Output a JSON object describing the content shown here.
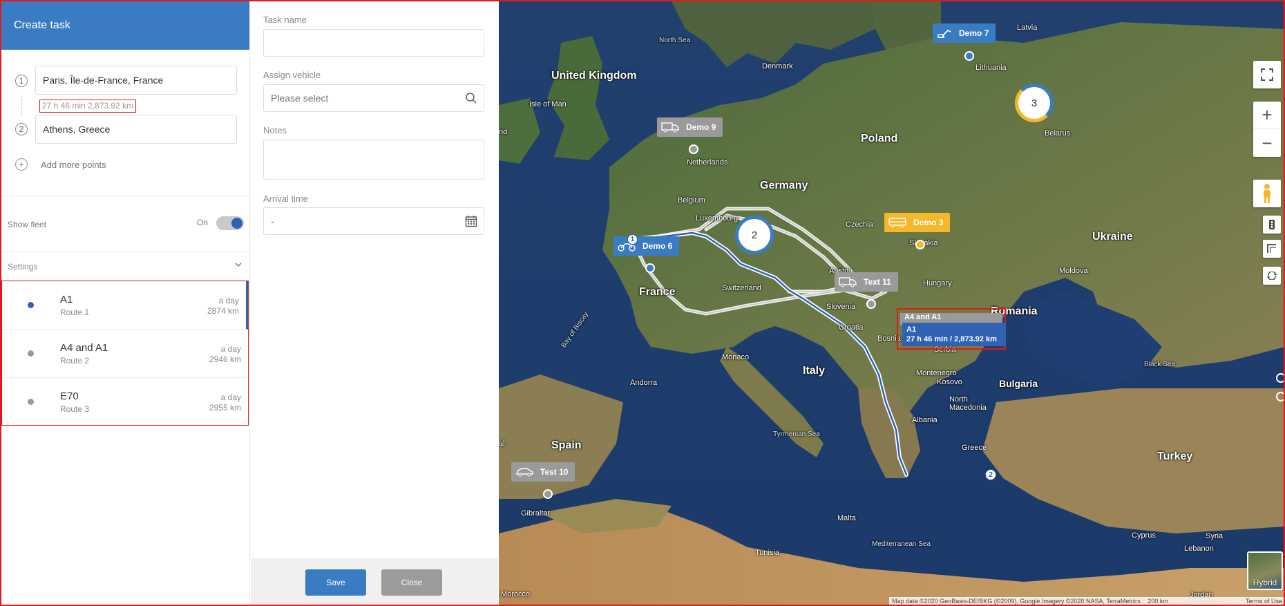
{
  "panel": {
    "title": "Create task",
    "points": [
      {
        "index": "1",
        "value": "Paris, Île-de-France, France"
      },
      {
        "index": "2",
        "value": "Athens, Greece"
      }
    ],
    "route_summary": "27 h 46 min 2,873.92 km",
    "add_more_label": "Add more points",
    "show_fleet_label": "Show fleet",
    "show_fleet_state": "On",
    "settings_label": "Settings",
    "routes": [
      {
        "name": "A1",
        "sub": "Route 1",
        "time": "a day",
        "distance": "2874 km",
        "active": true
      },
      {
        "name": "A4 and A1",
        "sub": "Route 2",
        "time": "a day",
        "distance": "2946 km",
        "active": false
      },
      {
        "name": "E70",
        "sub": "Route 3",
        "time": "a day",
        "distance": "2955 km",
        "active": false
      }
    ]
  },
  "form": {
    "task_name_label": "Task name",
    "task_name_value": "",
    "vehicle_label": "Assign vehicle",
    "vehicle_placeholder": "Please select",
    "notes_label": "Notes",
    "notes_value": "",
    "arrival_label": "Arrival time",
    "arrival_value": "-",
    "save_label": "Save",
    "close_label": "Close"
  },
  "map": {
    "countries": {
      "uk": "United Kingdom",
      "denmark": "Denmark",
      "netherlands": "Netherlands",
      "belgium": "Belgium",
      "luxembourg": "Luxembourg",
      "germany": "Germany",
      "poland": "Poland",
      "czechia": "Czechia",
      "slovakia": "Slovakia",
      "austria": "Austria",
      "hungary": "Hungary",
      "switzerland": "Switzerland",
      "france": "France",
      "slovenia": "Slovenia",
      "croatia": "Croatia",
      "bosnia": "Bosnia and Herzegovina",
      "serbia": "Serbia",
      "romania": "Romania",
      "montenegro": "Montenegro",
      "kosovo": "Kosovo",
      "north_macedonia": "North Macedonia",
      "albania": "Albania",
      "bulgaria": "Bulgaria",
      "greece": "Greece",
      "italy": "Italy",
      "spain": "Spain",
      "andorra": "Andorra",
      "monaco": "Monaco",
      "malta": "Malta",
      "tunisia": "Tunisia",
      "morocco": "Morocco",
      "gibraltar": "Gibraltar",
      "turkey": "Turkey",
      "ukraine": "Ukraine",
      "belarus": "Belarus",
      "lithuania": "Lithuania",
      "latvia": "Latvia",
      "moldova": "Moldova",
      "cyprus": "Cyprus",
      "syria": "Syria",
      "lebanon": "Lebanon",
      "jordan": "Jordan",
      "isle_of_man": "Isle of Man",
      "ireland_partial": "nd"
    },
    "seas": {
      "north_sea": "North Sea",
      "bay_of_biscay": "Bay of Biscay",
      "tyrrhenian": "Tyrrhenian Sea",
      "mediterranean": "Mediterranean Sea",
      "black_sea": "Black Sea",
      "portugal_partial": "al"
    },
    "vehicles": {
      "demo7": "Demo 7",
      "demo9": "Demo 9",
      "demo3": "Demo 3",
      "demo6": "Demo 6",
      "text11": "Text 11",
      "test10": "Test 10"
    },
    "clusters": {
      "c2": "2",
      "c3": "3"
    },
    "markers": {
      "start": "1",
      "end": "2"
    },
    "tooltip": {
      "back_name": "A4 and A1",
      "name": "A1",
      "detail": "27 h 46 min / 2,873.92 km"
    },
    "attribution": "Map data ©2020 GeoBasis-DE/BKG (©2009), Google Imagery ©2020 NASA, TerraMetrics",
    "scale_label": "200 km",
    "terms_label": "Terms of Use",
    "hybrid_label": "Hybrid"
  },
  "colors": {
    "accent": "#3a7cc3",
    "route_active": "#2f62b3",
    "highlight": "#e0191b",
    "orange": "#f4b82a"
  }
}
